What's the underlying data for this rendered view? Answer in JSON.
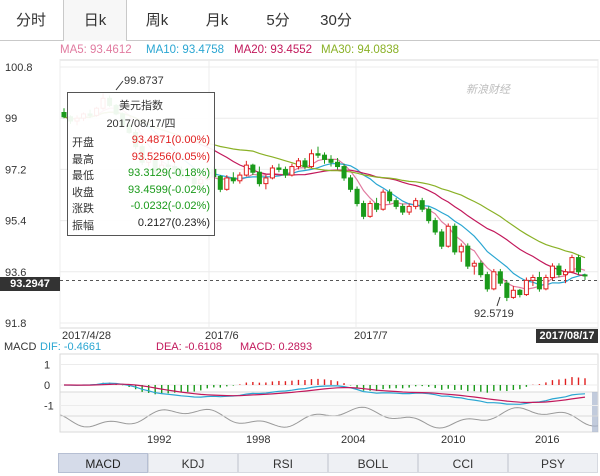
{
  "tabs": [
    "分时",
    "日k",
    "周k",
    "月k",
    "5分",
    "30分"
  ],
  "active_tab": "日k",
  "ma_legend": [
    {
      "label": "MA5: 93.4612",
      "color": "#e17ba0"
    },
    {
      "label": "MA10: 93.4758",
      "color": "#2aa6d2"
    },
    {
      "label": "MA20: 93.4552",
      "color": "#c2185b"
    },
    {
      "label": "MA30: 94.0838",
      "color": "#8ab126"
    }
  ],
  "watermark": "新浪财经",
  "tooltip": {
    "title": "美元指数",
    "date": "2017/08/17/四",
    "rows": [
      {
        "label": "开盘",
        "value": "93.4871(0.00%)",
        "color": "#e02020"
      },
      {
        "label": "最高",
        "value": "93.5256(0.05%)",
        "color": "#e02020"
      },
      {
        "label": "最低",
        "value": "93.3129(-0.18%)",
        "color": "#1a9a1a"
      },
      {
        "label": "收盘",
        "value": "93.4599(-0.02%)",
        "color": "#1a9a1a"
      },
      {
        "label": "涨跌",
        "value": "-0.0232(-0.02%)",
        "color": "#1a9a1a"
      },
      {
        "label": "振幅",
        "value": "0.2127(0.23%)",
        "color": "#222222"
      }
    ]
  },
  "price_axis": {
    "labels": [
      "100.8",
      "99",
      "97.2",
      "95.4",
      "93.6",
      "91.8"
    ]
  },
  "annotations": {
    "high": "99.8737",
    "low": "92.5719"
  },
  "current_price_tag": "93.2947",
  "date_axis": {
    "labels": [
      "2017/4/28",
      "2017/6",
      "2017/7"
    ],
    "cursor_date": "2017/08/17"
  },
  "macd": {
    "legend": [
      {
        "label": "MACD",
        "color": "#333333"
      },
      {
        "label": "DIF: -0.4661",
        "color": "#2aa6d2"
      },
      {
        "label": "DEA: -0.6108",
        "color": "#c2185b"
      },
      {
        "label": "MACD: 0.2893",
        "color": "#c2185b"
      }
    ],
    "axis_labels": [
      "1",
      "0",
      "-1"
    ]
  },
  "overview_years": [
    "1992",
    "1998",
    "2004",
    "2010",
    "2016"
  ],
  "indicator_tabs": [
    "MACD",
    "KDJ",
    "RSI",
    "BOLL",
    "CCI",
    "PSY"
  ],
  "active_indicator": "MACD",
  "chart_data": {
    "type": "candlestick",
    "title": "美元指数",
    "x_range": [
      "2017/4/28",
      "2017/8/17"
    ],
    "ylim": [
      91.8,
      100.8
    ],
    "ohlc": [
      [
        99.2,
        99.35,
        99.0,
        99.05
      ],
      [
        99.05,
        99.1,
        98.8,
        98.9
      ],
      [
        98.9,
        99.1,
        98.75,
        99.0
      ],
      [
        99.0,
        99.2,
        98.9,
        99.15
      ],
      [
        99.15,
        99.3,
        99.0,
        99.1
      ],
      [
        99.1,
        99.4,
        99.05,
        99.35
      ],
      [
        99.35,
        99.87,
        99.3,
        99.7
      ],
      [
        99.7,
        99.8,
        99.4,
        99.45
      ],
      [
        99.45,
        99.5,
        99.1,
        99.15
      ],
      [
        99.15,
        99.2,
        98.7,
        98.75
      ],
      [
        98.75,
        98.9,
        98.45,
        98.5
      ],
      [
        98.5,
        98.6,
        97.9,
        98.0
      ],
      [
        98.0,
        98.1,
        97.35,
        97.45
      ],
      [
        97.45,
        97.7,
        97.3,
        97.55
      ],
      [
        97.55,
        97.7,
        97.0,
        97.1
      ],
      [
        97.1,
        97.5,
        96.95,
        97.35
      ],
      [
        97.35,
        97.6,
        97.2,
        97.3
      ],
      [
        97.3,
        97.5,
        97.05,
        97.2
      ],
      [
        97.2,
        97.3,
        96.85,
        96.95
      ],
      [
        96.95,
        97.1,
        96.8,
        96.9
      ],
      [
        96.9,
        97.1,
        96.6,
        96.7
      ],
      [
        96.7,
        97.0,
        96.55,
        96.85
      ],
      [
        96.85,
        97.3,
        96.8,
        97.2
      ],
      [
        97.2,
        97.3,
        96.9,
        96.95
      ],
      [
        96.95,
        97.0,
        96.4,
        96.5
      ],
      [
        96.5,
        97.0,
        96.45,
        96.9
      ],
      [
        96.9,
        97.1,
        96.7,
        96.8
      ],
      [
        96.8,
        97.1,
        96.7,
        97.0
      ],
      [
        97.0,
        97.5,
        96.95,
        97.35
      ],
      [
        97.35,
        97.4,
        97.0,
        97.1
      ],
      [
        97.1,
        97.3,
        96.6,
        96.7
      ],
      [
        96.7,
        97.0,
        96.5,
        96.9
      ],
      [
        96.9,
        97.35,
        96.85,
        97.25
      ],
      [
        97.25,
        97.4,
        97.1,
        97.2
      ],
      [
        97.2,
        97.3,
        96.9,
        97.0
      ],
      [
        97.0,
        97.4,
        96.95,
        97.3
      ],
      [
        97.3,
        97.6,
        97.2,
        97.5
      ],
      [
        97.5,
        97.6,
        97.2,
        97.3
      ],
      [
        97.3,
        97.9,
        97.25,
        97.75
      ],
      [
        97.75,
        98.0,
        97.6,
        97.7
      ],
      [
        97.7,
        97.8,
        97.4,
        97.55
      ],
      [
        97.55,
        97.7,
        97.3,
        97.45
      ],
      [
        97.45,
        97.6,
        97.2,
        97.3
      ],
      [
        97.3,
        97.4,
        96.8,
        96.9
      ],
      [
        96.9,
        97.0,
        96.4,
        96.5
      ],
      [
        96.5,
        96.6,
        95.9,
        96.0
      ],
      [
        96.0,
        96.1,
        95.45,
        95.55
      ],
      [
        95.55,
        96.1,
        95.5,
        96.0
      ],
      [
        96.0,
        96.2,
        95.7,
        95.8
      ],
      [
        95.8,
        96.5,
        95.75,
        96.4
      ],
      [
        96.4,
        96.5,
        96.0,
        96.1
      ],
      [
        96.1,
        96.2,
        95.8,
        95.9
      ],
      [
        95.9,
        96.0,
        95.6,
        95.7
      ],
      [
        95.7,
        96.0,
        95.6,
        95.9
      ],
      [
        95.9,
        96.2,
        95.8,
        96.1
      ],
      [
        96.1,
        96.2,
        95.7,
        95.8
      ],
      [
        95.8,
        95.9,
        95.3,
        95.4
      ],
      [
        95.4,
        95.5,
        94.9,
        95.0
      ],
      [
        95.0,
        95.1,
        94.4,
        94.5
      ],
      [
        94.5,
        95.3,
        94.45,
        95.2
      ],
      [
        95.2,
        95.3,
        94.2,
        94.3
      ],
      [
        94.3,
        94.6,
        93.95,
        94.5
      ],
      [
        94.5,
        94.6,
        93.7,
        93.8
      ],
      [
        93.8,
        94.0,
        93.5,
        93.9
      ],
      [
        93.9,
        94.0,
        93.4,
        93.5
      ],
      [
        93.5,
        93.6,
        92.9,
        93.0
      ],
      [
        93.0,
        93.7,
        92.95,
        93.6
      ],
      [
        93.6,
        93.7,
        93.1,
        93.2
      ],
      [
        93.2,
        93.3,
        92.57,
        92.7
      ],
      [
        92.7,
        93.1,
        92.65,
        92.95
      ],
      [
        92.95,
        93.0,
        92.7,
        92.8
      ],
      [
        92.8,
        93.4,
        92.75,
        93.3
      ],
      [
        93.3,
        93.5,
        93.1,
        93.4
      ],
      [
        93.4,
        93.6,
        92.9,
        93.0
      ],
      [
        93.0,
        93.5,
        92.95,
        93.4
      ],
      [
        93.4,
        93.9,
        93.3,
        93.8
      ],
      [
        93.8,
        93.9,
        93.4,
        93.5
      ],
      [
        93.5,
        93.7,
        93.2,
        93.6
      ],
      [
        93.6,
        94.2,
        93.55,
        94.1
      ],
      [
        94.1,
        94.2,
        93.5,
        93.6
      ],
      [
        93.49,
        93.53,
        93.31,
        93.46
      ]
    ]
  }
}
